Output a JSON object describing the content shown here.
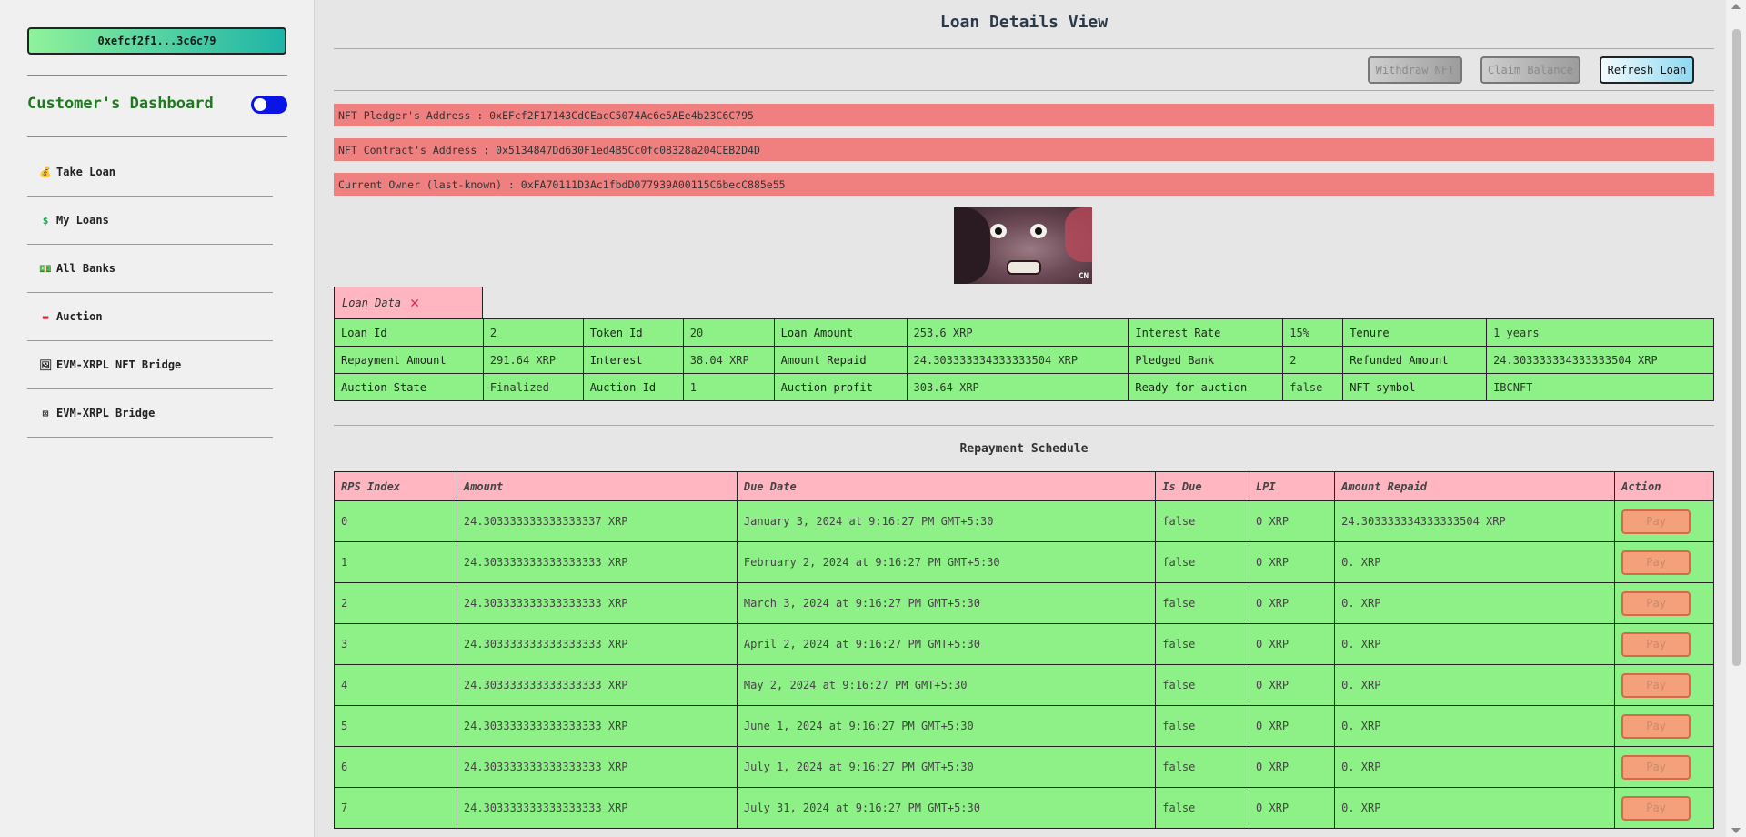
{
  "sidebar": {
    "wallet_address": "0xefcf2f1...3c6c79",
    "dashboard_title": "Customer's Dashboard",
    "items": [
      {
        "label": "Take Loan",
        "icon": "money-bag-icon",
        "glyph": "💰"
      },
      {
        "label": "My Loans",
        "icon": "dollar-icon",
        "glyph": "$"
      },
      {
        "label": "All Banks",
        "icon": "bank-notes-icon",
        "glyph": "💵"
      },
      {
        "label": "Auction",
        "icon": "auction-icon",
        "glyph": "▬"
      },
      {
        "label": "EVM-XRPL NFT Bridge",
        "icon": "nft-bridge-icon",
        "glyph": "🖼"
      },
      {
        "label": "EVM-XRPL Bridge",
        "icon": "bridge-icon",
        "glyph": "⊠"
      }
    ]
  },
  "main": {
    "title": "Loan Details View",
    "buttons": {
      "withdraw": "Withdraw NFT",
      "claim": "Claim Balance",
      "refresh": "Refresh Loan"
    },
    "addresses": {
      "pledger": "NFT Pledger's Address : 0xEFcf2F17143CdCEacC5074Ac6e5AEe4b23C6C795",
      "contract": "NFT Contract's Address : 0x5134847Dd630F1ed4B5Cc0fc08328a204CEB2D4D",
      "owner": "Current Owner (last-known) : 0xFA70111D3Ac1fbdD077939A00115C6becC885e55"
    },
    "nft_logo": "CN",
    "loan_tab": "Loan Data",
    "loan_rows": [
      [
        "Loan Id",
        "2",
        "Token Id",
        "20",
        "Loan Amount",
        "253.6 XRP",
        "Interest Rate",
        "15%",
        "Tenure",
        "1 years"
      ],
      [
        "Repayment Amount",
        "291.64 XRP",
        "Interest",
        "38.04 XRP",
        "Amount Repaid",
        "24.303333334333333504 XRP",
        "Pledged Bank",
        "2",
        "Refunded Amount",
        "24.303333334333333504 XRP"
      ],
      [
        "Auction State",
        "Finalized",
        "Auction Id",
        "1",
        "Auction profit",
        "303.64 XRP",
        "Ready for auction",
        "false",
        "NFT symbol",
        "IBCNFT"
      ]
    ],
    "schedule_title": "Repayment Schedule",
    "schedule_headers": [
      "RPS Index",
      "Amount",
      "Due Date",
      "Is Due",
      "LPI",
      "Amount Repaid",
      "Action"
    ],
    "schedule_rows": [
      [
        "0",
        "24.303333333333333337 XRP",
        "January 3, 2024 at 9:16:27 PM GMT+5:30",
        "false",
        "0 XRP",
        "24.303333334333333504 XRP"
      ],
      [
        "1",
        "24.303333333333333333 XRP",
        "February 2, 2024 at 9:16:27 PM GMT+5:30",
        "false",
        "0 XRP",
        "0. XRP"
      ],
      [
        "2",
        "24.303333333333333333 XRP",
        "March 3, 2024 at 9:16:27 PM GMT+5:30",
        "false",
        "0 XRP",
        "0. XRP"
      ],
      [
        "3",
        "24.303333333333333333 XRP",
        "April 2, 2024 at 9:16:27 PM GMT+5:30",
        "false",
        "0 XRP",
        "0. XRP"
      ],
      [
        "4",
        "24.303333333333333333 XRP",
        "May 2, 2024 at 9:16:27 PM GMT+5:30",
        "false",
        "0 XRP",
        "0. XRP"
      ],
      [
        "5",
        "24.303333333333333333 XRP",
        "June 1, 2024 at 9:16:27 PM GMT+5:30",
        "false",
        "0 XRP",
        "0. XRP"
      ],
      [
        "6",
        "24.303333333333333333 XRP",
        "July 1, 2024 at 9:16:27 PM GMT+5:30",
        "false",
        "0 XRP",
        "0. XRP"
      ],
      [
        "7",
        "24.303333333333333333 XRP",
        "July 31, 2024 at 9:16:27 PM GMT+5:30",
        "false",
        "0 XRP",
        "0. XRP"
      ]
    ],
    "pay_label": "Pay"
  },
  "colors": {
    "address_bar": "#f08080",
    "table_cell": "#8ef187",
    "table_header": "#ffb6c1",
    "toggle": "#0a14e6"
  }
}
